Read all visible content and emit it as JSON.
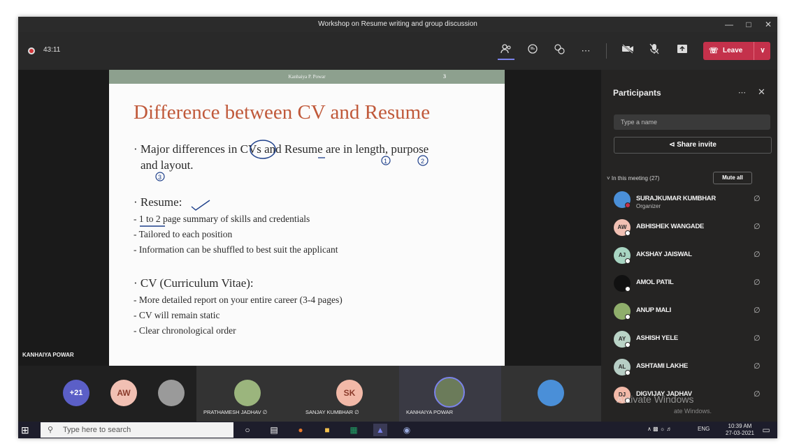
{
  "window": {
    "title": "Workshop on Resume writing and group discussion",
    "minimize_icon": "minimize-icon",
    "restore_icon": "restore-icon",
    "close_icon": "close-icon"
  },
  "toolbar": {
    "recording_time": "43:11",
    "leave_label": "Leave",
    "icons": [
      "participants-icon",
      "chat-icon",
      "reactions-icon",
      "more-icon",
      "camera-off-icon",
      "mic-off-icon",
      "share-tray-icon",
      "phone-icon",
      "chevron-down-icon"
    ]
  },
  "slide": {
    "header_author": "Kanhaiya P. Powar",
    "page_number": "3",
    "title": "Difference between CV and Resume",
    "intro_pre": "Major differences in ",
    "intro_cvs": "CVs",
    "intro_mid": " and Resume are in length, purpose",
    "intro_line2": "and layout.",
    "resume_heading": "Resume:",
    "resume_points": [
      "- 1 to 2 page summary of skills and credentials",
      "- Tailored to each position",
      "- Information can be shuffled to best suit the applicant"
    ],
    "cv_heading": "CV (Curriculum Vitae):",
    "cv_points": [
      "- More detailed report on your entire career (3-4 pages)",
      "- CV will remain static",
      "- Clear chronological order"
    ],
    "annotations": [
      "1",
      "2",
      "3"
    ]
  },
  "stage": {
    "speaker_name": "KANHAIYA POWAR"
  },
  "participants_panel": {
    "title": "Participants",
    "search_placeholder": "Type a name",
    "share_invite": "Share invite",
    "section_label": "In this meeting (27)",
    "mute_all": "Mute all",
    "people": [
      {
        "name": "SURAJKUMAR KUMBHAR",
        "role": "Organizer",
        "initials": "",
        "color": "#4a8fd8"
      },
      {
        "name": "ABHISHEK WANGADE",
        "role": "",
        "initials": "AW",
        "color": "#f1c0b3"
      },
      {
        "name": "AKSHAY JAISWAL",
        "role": "",
        "initials": "AJ",
        "color": "#a8d5c2"
      },
      {
        "name": "AMOL PATIL",
        "role": "",
        "initials": "",
        "color": "#111111"
      },
      {
        "name": "ANUP MALI",
        "role": "",
        "initials": "",
        "color": "#8fae6b"
      },
      {
        "name": "ASHISH YELE",
        "role": "",
        "initials": "AY",
        "color": "#b9d3c6"
      },
      {
        "name": "ASHTAMI LAKHE",
        "role": "",
        "initials": "AL",
        "color": "#b7cec5"
      },
      {
        "name": "DIGVIJAY JADHAV",
        "role": "",
        "initials": "DJ",
        "color": "#f2b9a8"
      }
    ],
    "watermark_line1": "Activate Windows",
    "watermark_line2": "ate Windows."
  },
  "video_strip": {
    "overflow_count": "+21",
    "avatar_aw": "AW",
    "tiles": [
      {
        "name": "PRATHAMESH JADHAV",
        "initials": ""
      },
      {
        "name": "SANJAY KUMBHAR",
        "initials": "SK"
      },
      {
        "name": "KANHAIYA POWAR",
        "initials": ""
      },
      {
        "name": "",
        "initials": ""
      }
    ]
  },
  "taskbar": {
    "search_placeholder": "Type here to search",
    "language": "ENG",
    "time": "10:39 AM",
    "date": "27-03-2021"
  }
}
